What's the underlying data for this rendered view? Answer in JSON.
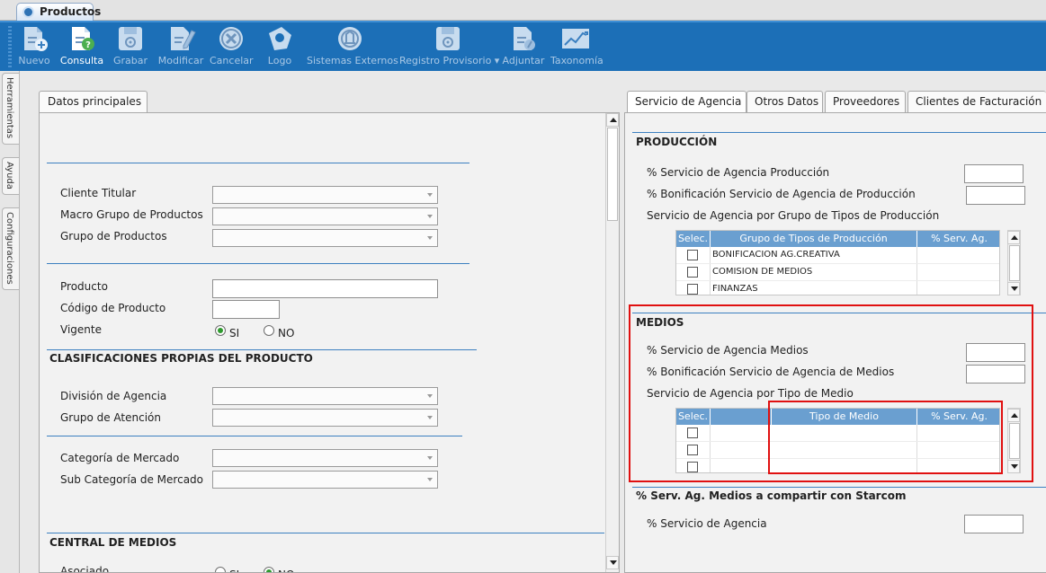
{
  "window_tab": {
    "title": "Productos"
  },
  "toolbar": {
    "buttons": [
      {
        "label": "Nuevo",
        "icon": "new-document-icon"
      },
      {
        "label": "Consulta",
        "icon": "query-document-icon"
      },
      {
        "label": "Grabar",
        "icon": "save-icon"
      },
      {
        "label": "Modificar",
        "icon": "edit-icon"
      },
      {
        "label": "Cancelar",
        "icon": "cancel-icon"
      },
      {
        "label": "Logo",
        "icon": "logo-icon"
      },
      {
        "label": "Sistemas Externos",
        "icon": "external-systems-icon"
      },
      {
        "label": "Registro Provisorio",
        "icon": "provisional-save-icon"
      },
      {
        "label": "Adjuntar",
        "icon": "attach-icon"
      },
      {
        "label": "Taxonomía",
        "icon": "chart-icon"
      }
    ],
    "dropdown_arrow": "▾"
  },
  "side_tabs": {
    "herramientas": "Herramientas",
    "ayuda": "Ayuda",
    "configuraciones": "Configuraciones"
  },
  "left": {
    "tab": "Datos principales",
    "cliente_titular": "Cliente Titular",
    "macro_grupo": "Macro Grupo de Productos",
    "grupo_productos": "Grupo de Productos",
    "producto": "Producto",
    "codigo": "Código de Producto",
    "vigente": "Vigente",
    "si": "SI",
    "no": "NO",
    "clasificaciones": "CLASIFICACIONES PROPIAS DEL PRODUCTO",
    "division": "División de Agencia",
    "grupo_atencion": "Grupo de Atención",
    "categoria": "Categoría de Mercado",
    "sub_categoria": "Sub Categoría de Mercado",
    "central_medios": "CENTRAL DE MEDIOS",
    "asociado": "Asociado",
    "asociado_si": "SI",
    "asociado_no": "NO"
  },
  "right": {
    "tabs": [
      "Servicio de Agencia",
      "Otros Datos",
      "Proveedores",
      "Clientes de Facturación"
    ],
    "produccion": {
      "title": "PRODUCCIÓN",
      "pct_servicio": "% Servicio de Agencia Producción",
      "pct_bonificacion": "% Bonificación Servicio de Agencia de Producción",
      "por_grupo": "Servicio de Agencia por Grupo de Tipos de Producción",
      "grid_headers": [
        "Selec.",
        "Grupo de Tipos de Producción",
        "% Serv. Ag."
      ],
      "rows": [
        "BONIFICACION AG.CREATIVA",
        "COMISION DE MEDIOS",
        "FINANZAS"
      ]
    },
    "medios": {
      "title": "MEDIOS",
      "pct_servicio": "% Servicio de Agencia Medios",
      "pct_bonificacion": "% Bonificación Servicio de Agencia de Medios",
      "por_tipo": "Servicio de Agencia por Tipo de Medio",
      "grid_headers": [
        "Selec.",
        "",
        "Tipo de Medio",
        "% Serv. Ag."
      ]
    },
    "starcom": {
      "title": "% Serv. Ag. Medios a compartir con Starcom",
      "pct_servicio": "% Servicio de Agencia"
    }
  }
}
